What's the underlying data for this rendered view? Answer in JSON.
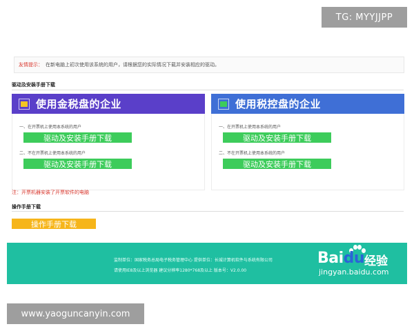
{
  "badges": {
    "tg": "TG: MYYJJPP",
    "site": "www.yaoguncanyin.com"
  },
  "notice": {
    "label": "友情提示：",
    "text": "在新电脑上初次使用该系统的用户，请根据您的实际情况下载并安装相应的驱动。"
  },
  "sections": {
    "driver_title": "驱动及安装手册下载",
    "manual_title": "操作手册下载"
  },
  "panels": [
    {
      "title": "使用金税盘的企业",
      "header_color": "#5a3fc9",
      "icon_color": "#f3c623",
      "line1": "一、在开票机上使用本系统的用户",
      "button1": "驱动及安装手册下载",
      "line2": "二、不在开票机上使用本系统的用户",
      "button2": "驱动及安装手册下载"
    },
    {
      "title": "使用税控盘的企业",
      "header_color": "#3f6fd6",
      "icon_color": "#3dcc5b",
      "line1": "一、在开票机上使用本系统的用户",
      "button1": "驱动及安装手册下载",
      "line2": "二、不在开票机上使用本系统的用户",
      "button2": "驱动及安装手册下载"
    }
  ],
  "note": "注：开票机器安装了开票软件的电脑",
  "manual_button": "操作手册下载",
  "footer": {
    "line1": "监制单位：国家税务总局电子税务管理中心    提供单位：长城计算机软件与系统有限公司",
    "line2": "请使用IE8及以上浏览器    建议分辨率1280*768及以上    版本号：V2.0.00",
    "color": "#1fbfa1"
  },
  "watermark": {
    "logo_left": "Bai",
    "logo_right": "du",
    "suffix": "经验",
    "url": "jingyan.baidu.com"
  }
}
